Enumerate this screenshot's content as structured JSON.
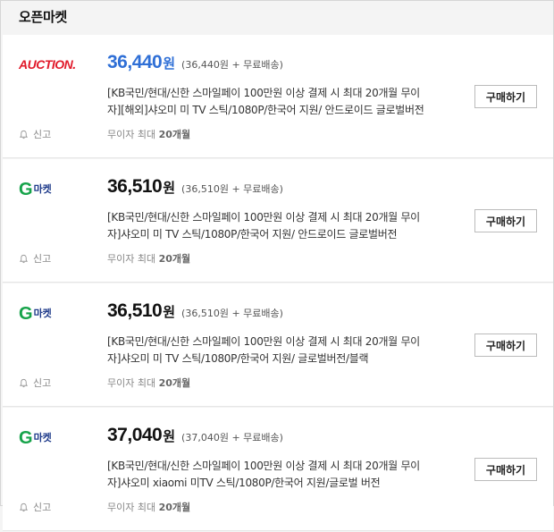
{
  "section": {
    "title": "오픈마켓"
  },
  "listings": [
    {
      "seller": "auction",
      "logo_text": "AUCTION.",
      "price": "36,440",
      "won": "원",
      "price_detail": "(36,440원 + 무료배송)",
      "desc_line1": "[KB국민/현대/신한 스마일페이 100만원 이상 결제 시 최대 20개월 무이",
      "desc_line2": "자][해외]샤오미 미 TV 스틱/1080P/한국어 지원/ 안드로이드 글로벌버전",
      "buy_label": "구매하기",
      "report_label": "신고",
      "installment_prefix": "무이자 최대 ",
      "installment_value": "20개월",
      "price_color": "#2f6fd6"
    },
    {
      "seller": "gmarket",
      "logo_g": "G",
      "logo_text": "마켓",
      "price": "36,510",
      "won": "원",
      "price_detail": "(36,510원 + 무료배송)",
      "desc_line1": "[KB국민/현대/신한 스마일페이 100만원 이상 결제 시 최대 20개월 무이",
      "desc_line2": "자]샤오미 미 TV 스틱/1080P/한국어 지원/ 안드로이드 글로벌버전",
      "buy_label": "구매하기",
      "report_label": "신고",
      "installment_prefix": "무이자 최대 ",
      "installment_value": "20개월"
    },
    {
      "seller": "gmarket",
      "logo_g": "G",
      "logo_text": "마켓",
      "price": "36,510",
      "won": "원",
      "price_detail": "(36,510원 + 무료배송)",
      "desc_line1": "[KB국민/현대/신한 스마일페이 100만원 이상 결제 시 최대 20개월 무이",
      "desc_line2": "자]샤오미 미 TV 스틱/1080P/한국어 지원/ 글로벌버전/블랙",
      "buy_label": "구매하기",
      "report_label": "신고",
      "installment_prefix": "무이자 최대 ",
      "installment_value": "20개월"
    },
    {
      "seller": "gmarket",
      "logo_g": "G",
      "logo_text": "마켓",
      "price": "37,040",
      "won": "원",
      "price_detail": "(37,040원 + 무료배송)",
      "desc_line1": "[KB국민/현대/신한 스마일페이 100만원 이상 결제 시 최대 20개월 무이",
      "desc_line2": "자]샤오미 xiaomi 미TV 스틱/1080P/한국어 지원/글로벌 버전",
      "buy_label": "구매하기",
      "report_label": "신고",
      "installment_prefix": "무이자 최대 ",
      "installment_value": "20개월"
    }
  ]
}
